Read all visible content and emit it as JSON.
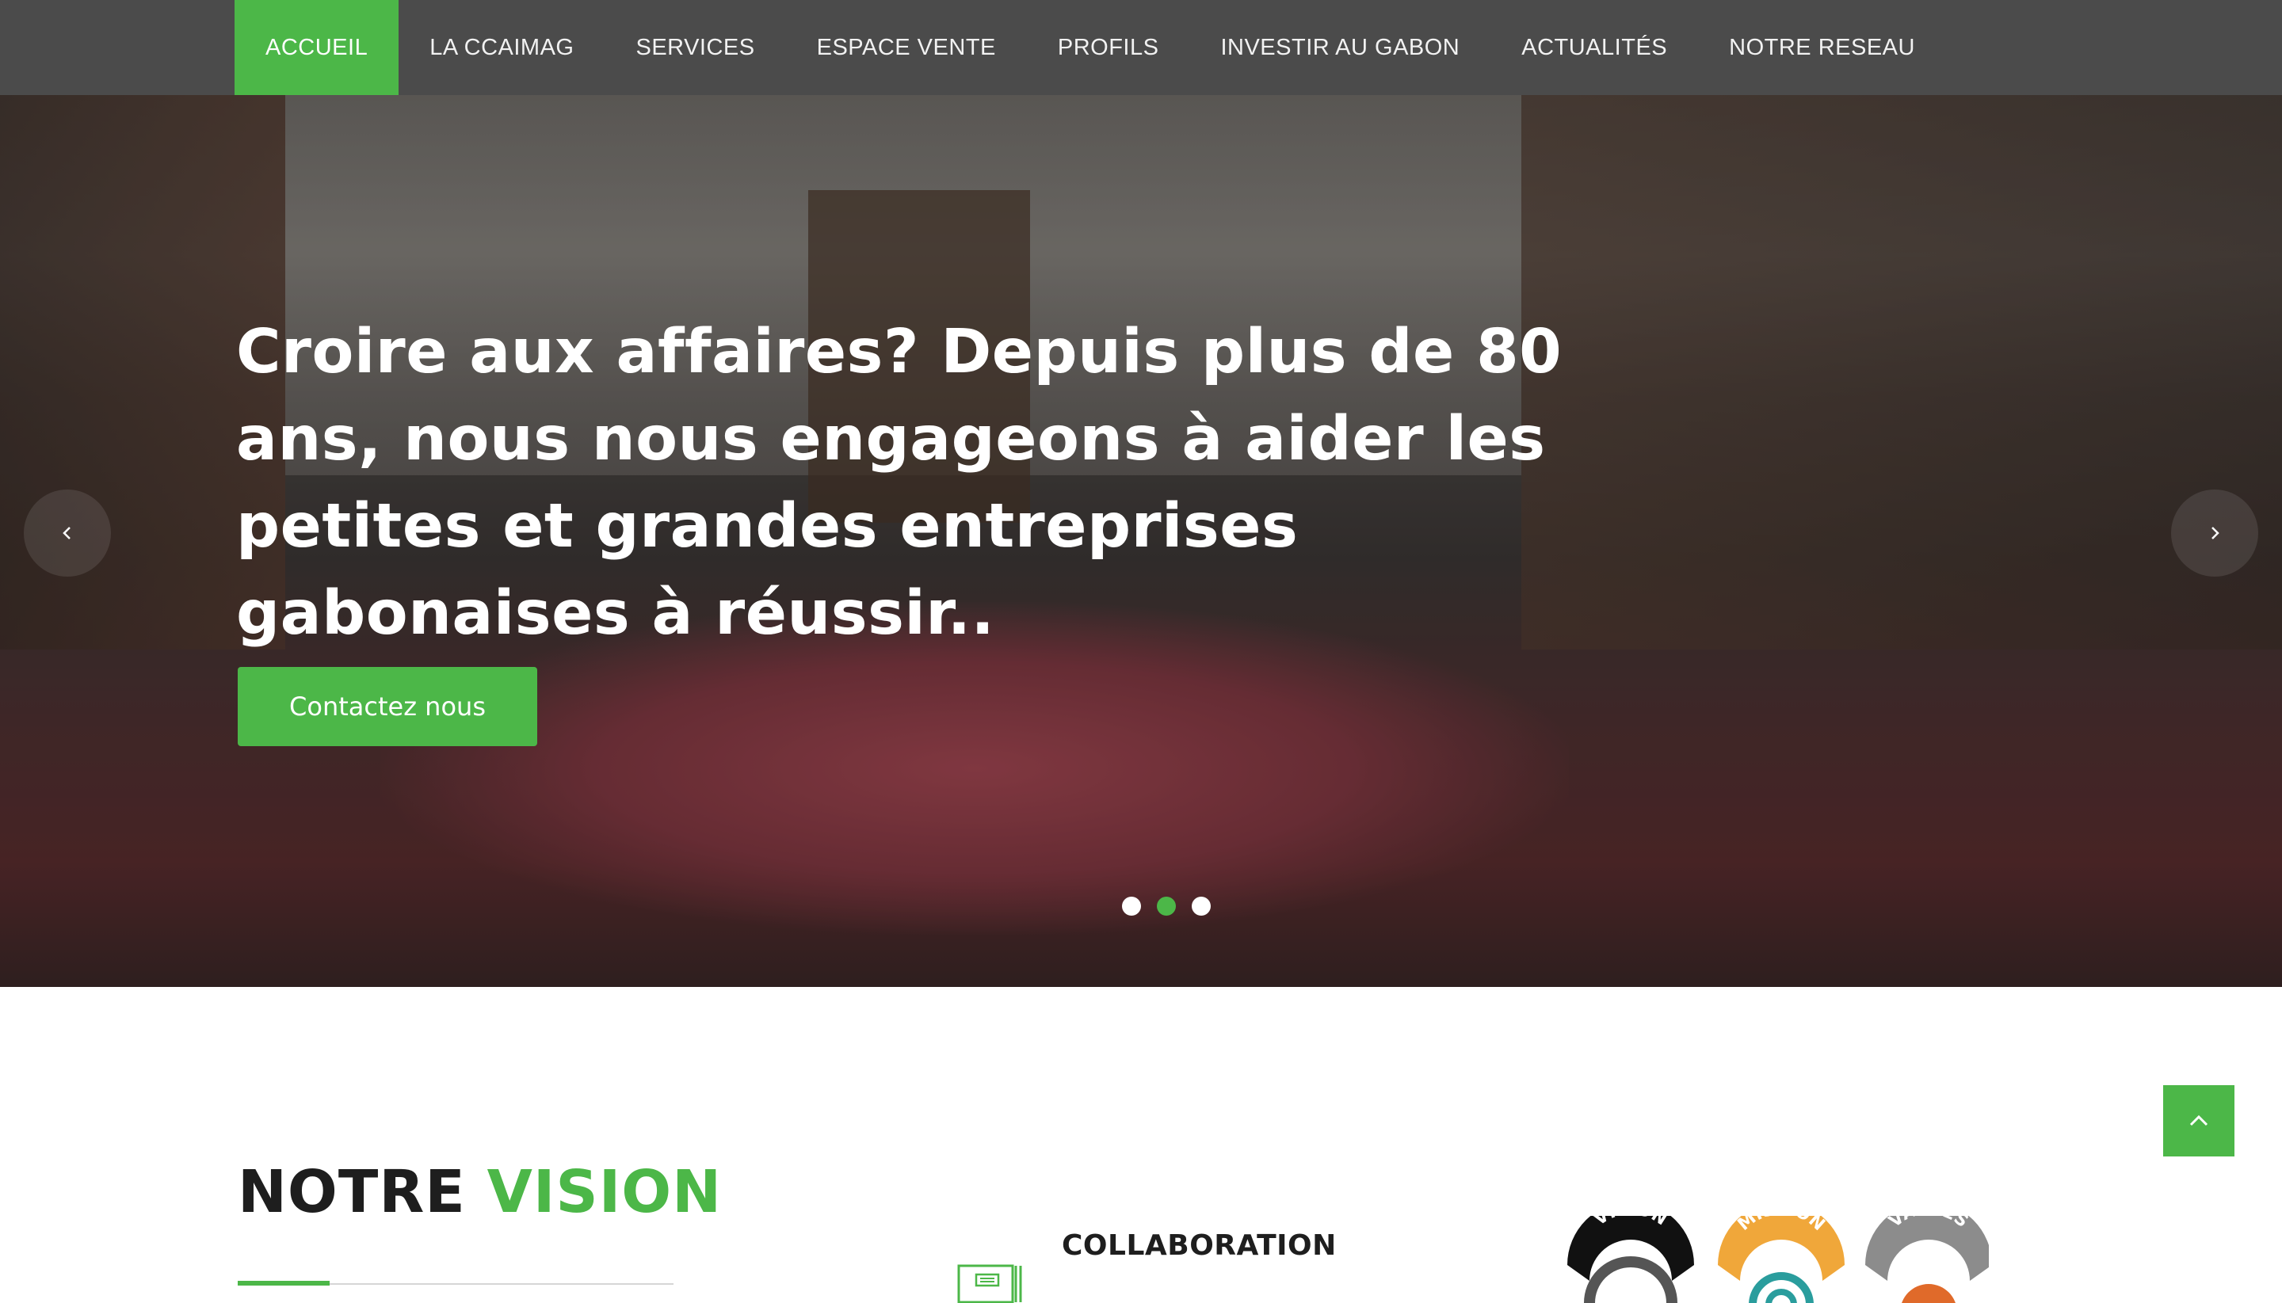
{
  "nav": {
    "items": [
      {
        "label": "ACCUEIL",
        "active": true
      },
      {
        "label": "LA CCAIMAG",
        "active": false
      },
      {
        "label": "SERVICES",
        "active": false
      },
      {
        "label": "ESPACE VENTE",
        "active": false
      },
      {
        "label": "PROFILS",
        "active": false
      },
      {
        "label": "INVESTIR AU GABON",
        "active": false
      },
      {
        "label": "ACTUALITÉS",
        "active": false
      },
      {
        "label": "NOTRE RESEAU",
        "active": false
      }
    ]
  },
  "hero": {
    "headline": "Croire aux affaires? Depuis plus de 80 ans, nous nous engageons à aider les petites et grandes entreprises gabonaises à réussir..",
    "cta_label": "Contactez nous",
    "prev_icon": "chevron-left-icon",
    "next_icon": "chevron-right-icon",
    "slides_total": 3,
    "active_slide": 2
  },
  "vision": {
    "title_part1": "NOTRE",
    "title_part2": "VISION",
    "collaboration_title": "COLLABORATION",
    "badges": [
      "VISION",
      "MISSION",
      "VALUES"
    ]
  },
  "scroll_top_icon": "chevron-up-icon",
  "colors": {
    "accent": "#4cb748",
    "nav_bg": "#4b4b4b",
    "badge_vision": "#111111",
    "badge_mission": "#f0a73a",
    "badge_values": "#8c8c8c"
  }
}
